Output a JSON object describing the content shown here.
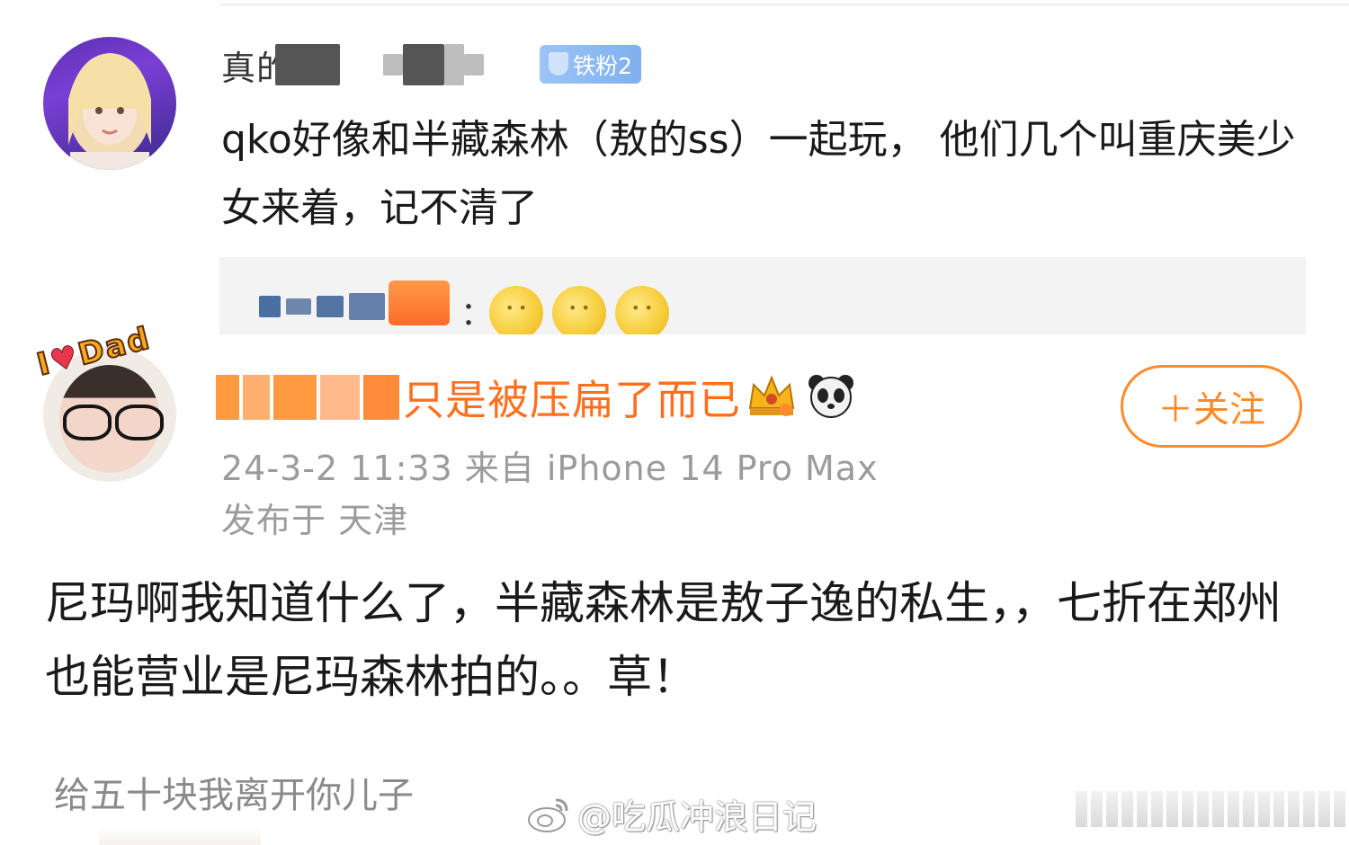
{
  "comment1": {
    "username_visible": "真的",
    "fan_badge": "铁粉2",
    "text": "qko好像和半藏森林（敖的ss）一起玩，  他们几个叫重庆美少女来着，记不清了",
    "reply": {
      "colon": "：",
      "emojis": [
        "moon-face-emoji",
        "moon-face-emoji",
        "moon-face-emoji"
      ]
    }
  },
  "post": {
    "avatar_sticker": "I Dad",
    "username_visible": "只是被压扁了而已",
    "icons": [
      "crown-icon",
      "panda-icon"
    ],
    "follow_button": "＋关注",
    "meta_time_device": "24-3-2 11:33  来自 iPhone 14 Pro Max",
    "meta_location": "发布于 天津",
    "text": "尼玛啊我知道什么了，半藏森林是敖子逸的私生，，七折在郑州也能营业是尼玛森林拍的。。草！"
  },
  "next_comment_preview": "给五十块我离开你儿子",
  "watermark": "@吃瓜冲浪日记",
  "colors": {
    "accent_orange": "#ff8a2a",
    "name_orange": "#ff6f1e",
    "meta_gray": "#9b9b9b",
    "fan_badge_blue": "#8ab8f2"
  }
}
